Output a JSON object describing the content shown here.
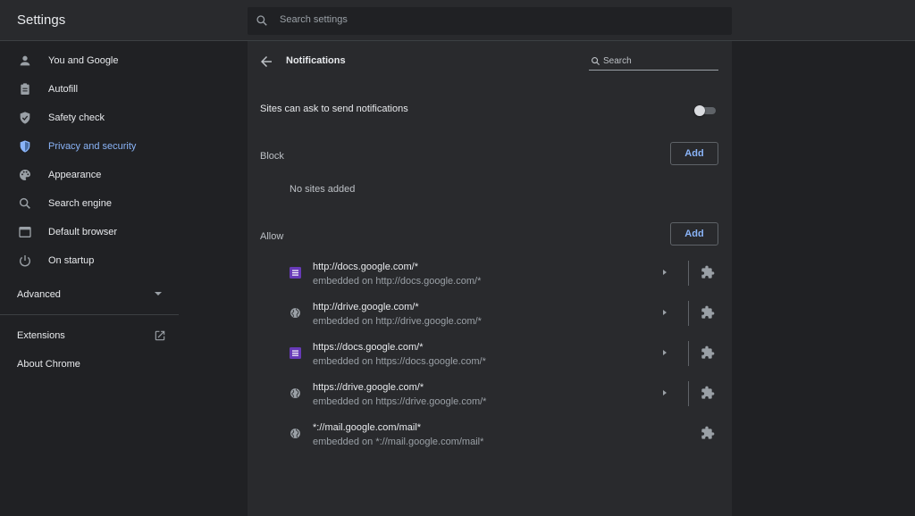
{
  "header": {
    "title": "Settings",
    "search_placeholder": "Search settings"
  },
  "sidebar": {
    "items": [
      {
        "label": "You and Google",
        "icon": "person-icon"
      },
      {
        "label": "Autofill",
        "icon": "clipboard-icon"
      },
      {
        "label": "Safety check",
        "icon": "shield-check-icon"
      },
      {
        "label": "Privacy and security",
        "icon": "shield-icon",
        "active": true
      },
      {
        "label": "Appearance",
        "icon": "palette-icon"
      },
      {
        "label": "Search engine",
        "icon": "search-icon"
      },
      {
        "label": "Default browser",
        "icon": "browser-icon"
      },
      {
        "label": "On startup",
        "icon": "power-icon"
      }
    ],
    "advanced_label": "Advanced",
    "extensions_label": "Extensions",
    "about_label": "About Chrome"
  },
  "main": {
    "title": "Notifications",
    "search_placeholder": "Search",
    "toggle_label": "Sites can ask to send notifications",
    "toggle_on": false,
    "block_label": "Block",
    "add_label": "Add",
    "block_empty": "No sites added",
    "allow_label": "Allow",
    "allow_sites": [
      {
        "url": "http://docs.google.com/*",
        "sub": "embedded on http://docs.google.com/*",
        "icon": "google-docs-icon"
      },
      {
        "url": "http://drive.google.com/*",
        "sub": "embedded on http://drive.google.com/*",
        "icon": "globe-icon"
      },
      {
        "url": "https://docs.google.com/*",
        "sub": "embedded on https://docs.google.com/*",
        "icon": "google-docs-icon"
      },
      {
        "url": "https://drive.google.com/*",
        "sub": "embedded on https://drive.google.com/*",
        "icon": "globe-icon"
      },
      {
        "url": "*://mail.google.com/mail*",
        "sub": "embedded on *://mail.google.com/mail*",
        "icon": "globe-icon"
      }
    ]
  },
  "colors": {
    "accent": "#8ab4f8",
    "background": "#202124",
    "surface": "#292a2d",
    "docs_purple": "#673ab7"
  }
}
